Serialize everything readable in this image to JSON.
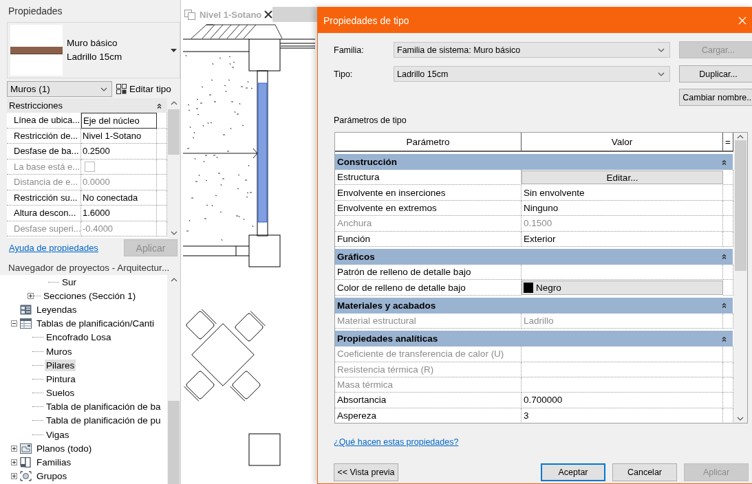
{
  "properties": {
    "title": "Propiedades",
    "type_family": "Muro básico",
    "type_name": "Ladrillo 15cm",
    "category": "Muros (1)",
    "edit_type": "Editar tipo",
    "section": {
      "label": "Restricciones",
      "expanded": true
    },
    "rows": [
      {
        "label": "Línea de ubica...",
        "value": "Eje del núcleo",
        "kind": "input",
        "disabled": false
      },
      {
        "label": "Restricción de...",
        "value": "Nivel 1-Sotano",
        "kind": "text",
        "disabled": false
      },
      {
        "label": "Desfase de ba...",
        "value": "0.2500",
        "kind": "text",
        "disabled": false
      },
      {
        "label": "La base está e...",
        "kind": "checkbox",
        "checked": false,
        "disabled": true
      },
      {
        "label": "Distancia de e...",
        "value": "0.0000",
        "kind": "text",
        "disabled": true
      },
      {
        "label": "Restricción su...",
        "value": "No conectada",
        "kind": "text",
        "disabled": false
      },
      {
        "label": "Altura descon...",
        "value": "1.6000",
        "kind": "text",
        "disabled": false
      },
      {
        "label": "Desfase superi...",
        "value": "-0.4000",
        "kind": "text",
        "disabled": true
      }
    ],
    "help_link": "Ayuda de propiedades",
    "apply": {
      "label": "Aplicar",
      "disabled": true
    }
  },
  "project_browser": {
    "title": "Navegador de proyectos - Arquitectur...",
    "continued": [
      {
        "label": "Sur",
        "selected": false
      }
    ],
    "items": [
      {
        "label": "Secciones (Sección 1)",
        "kind": "section",
        "expanded": false,
        "selected": false
      },
      {
        "label": "Leyendas",
        "kind": "legend",
        "selected": false
      },
      {
        "label": "Tablas de planificación/Canti",
        "kind": "schedule",
        "expanded": true,
        "selected": false,
        "children": [
          {
            "label": "Encofrado Losa",
            "selected": false
          },
          {
            "label": "Muros",
            "selected": false
          },
          {
            "label": "Pilares",
            "selected": true
          },
          {
            "label": "Pintura",
            "selected": false
          },
          {
            "label": "Suelos",
            "selected": false
          },
          {
            "label": "Tabla de planificación de ba",
            "selected": false
          },
          {
            "label": "Tabla de planificación de pu",
            "selected": false
          },
          {
            "label": "Vigas",
            "selected": false
          }
        ]
      },
      {
        "label": "Planos (todo)",
        "kind": "sheet",
        "expanded": false,
        "selected": false
      },
      {
        "label": "Familias",
        "kind": "family",
        "expanded": false,
        "selected": false
      },
      {
        "label": "Grupos",
        "kind": "groups",
        "expanded": false,
        "selected": false
      }
    ]
  },
  "view_tab": {
    "label": "Nivel 1-Sotano",
    "selected": false
  },
  "dialog": {
    "title": "Propiedades de tipo",
    "family": {
      "label": "Familia:",
      "value": "Familia de sistema: Muro básico"
    },
    "type": {
      "label": "Tipo:",
      "value": "Ladrillo 15cm"
    },
    "side_buttons": [
      {
        "label": "Cargar...",
        "disabled": true
      },
      {
        "label": "Duplicar...",
        "disabled": false
      },
      {
        "label": "Cambiar nombre...",
        "disabled": false
      }
    ],
    "params_label": "Parámetros de tipo",
    "columns": [
      "Parámetro",
      "Valor",
      "="
    ],
    "groups": [
      {
        "label": "Construcción",
        "expanded": true,
        "rows": [
          {
            "label": "Estructura",
            "kind": "button",
            "value": "Editar...",
            "disabled": false
          },
          {
            "label": "Envolvente en inserciones",
            "kind": "text",
            "value": "Sin envolvente",
            "disabled": false
          },
          {
            "label": "Envolvente en extremos",
            "kind": "text",
            "value": "Ninguno",
            "disabled": false
          },
          {
            "label": "Anchura",
            "kind": "text",
            "value": "0.1500",
            "disabled": true
          },
          {
            "label": "Función",
            "kind": "text",
            "value": "Exterior",
            "disabled": false
          }
        ]
      },
      {
        "label": "Gráficos",
        "expanded": true,
        "rows": [
          {
            "label": "Patrón de relleno de detalle bajo",
            "kind": "text",
            "disabled": false
          },
          {
            "label": "Color de relleno de detalle bajo",
            "kind": "color",
            "value": "Negro",
            "color": "#000000",
            "disabled": false
          }
        ]
      },
      {
        "label": "Materiales y acabados",
        "expanded": true,
        "rows": [
          {
            "label": "Material estructural",
            "kind": "text",
            "value": "Ladrillo",
            "disabled": true
          }
        ]
      },
      {
        "label": "Propiedades analíticas",
        "expanded": true,
        "rows": [
          {
            "label": "Coeficiente de transferencia de calor (U)",
            "kind": "text",
            "disabled": true
          },
          {
            "label": "Resistencia térmica (R)",
            "kind": "text",
            "disabled": true
          },
          {
            "label": "Masa térmica",
            "kind": "text",
            "disabled": true
          },
          {
            "label": "Absortancia",
            "kind": "text",
            "value": "0.700000",
            "disabled": false
          },
          {
            "label": "Aspereza",
            "kind": "text",
            "value": "3",
            "disabled": false
          }
        ]
      }
    ],
    "help_link": "¿Qué hacen estas propiedades?",
    "buttons": [
      {
        "label": "<< Vista previa",
        "disabled": false,
        "default": false
      },
      {
        "label": "Aceptar",
        "disabled": false,
        "default": true
      },
      {
        "label": "Cancelar",
        "disabled": false,
        "default": false
      },
      {
        "label": "Aplicar",
        "disabled": true,
        "default": false
      }
    ]
  }
}
